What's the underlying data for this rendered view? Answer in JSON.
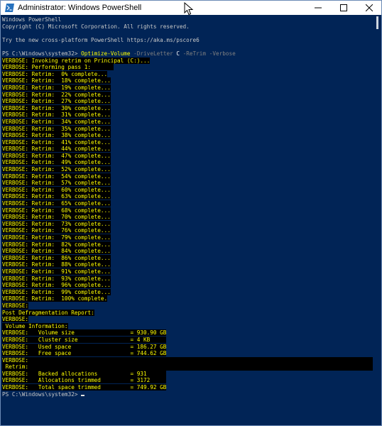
{
  "window": {
    "title": "Administrator: Windows PowerShell"
  },
  "console": {
    "header": [
      "Windows PowerShell",
      "Copyright (C) Microsoft Corporation. All rights reserved.",
      "",
      "Try the new cross-platform PowerShell https://aka.ms/pscore6",
      ""
    ],
    "command": {
      "prompt": "PS C:\\Windows\\system32> ",
      "cmdlet": "Optimize-Volume",
      "p1": "-DriveLetter",
      "a1": "C",
      "p2": "-ReTrim",
      "p3": "-Verbose"
    },
    "verbose_intro": [
      "VERBOSE: Invoking retrim on Principal (C:)...",
      "VERBOSE: Performing pass 1:"
    ],
    "progress": [
      "VERBOSE: Retrim:  0% complete...",
      "VERBOSE: Retrim:  18% complete...",
      "VERBOSE: Retrim:  19% complete...",
      "VERBOSE: Retrim:  22% complete...",
      "VERBOSE: Retrim:  27% complete...",
      "VERBOSE: Retrim:  30% complete...",
      "VERBOSE: Retrim:  31% complete...",
      "VERBOSE: Retrim:  34% complete...",
      "VERBOSE: Retrim:  35% complete...",
      "VERBOSE: Retrim:  38% complete...",
      "VERBOSE: Retrim:  41% complete...",
      "VERBOSE: Retrim:  44% complete...",
      "VERBOSE: Retrim:  47% complete...",
      "VERBOSE: Retrim:  49% complete...",
      "VERBOSE: Retrim:  52% complete...",
      "VERBOSE: Retrim:  54% complete...",
      "VERBOSE: Retrim:  57% complete...",
      "VERBOSE: Retrim:  60% complete...",
      "VERBOSE: Retrim:  63% complete...",
      "VERBOSE: Retrim:  65% complete...",
      "VERBOSE: Retrim:  68% complete...",
      "VERBOSE: Retrim:  70% complete...",
      "VERBOSE: Retrim:  73% complete...",
      "VERBOSE: Retrim:  76% complete...",
      "VERBOSE: Retrim:  79% complete...",
      "VERBOSE: Retrim:  82% complete...",
      "VERBOSE: Retrim:  84% complete...",
      "VERBOSE: Retrim:  86% complete...",
      "VERBOSE: Retrim:  88% complete...",
      "VERBOSE: Retrim:  91% complete...",
      "VERBOSE: Retrim:  93% complete...",
      "VERBOSE: Retrim:  96% complete...",
      "VERBOSE: Retrim:  99% complete...",
      "VERBOSE: Retrim:  100% complete."
    ],
    "report_lines": [
      "VERBOSE:",
      "Post Defragmentation Report:",
      "VERBOSE:",
      " Volume Information:",
      "VERBOSE:   Volume size                 = 930.90 GB",
      "VERBOSE:   Cluster size                = 4 KB",
      "VERBOSE:   Used space                  = 186.27 GB",
      "VERBOSE:   Free space                  = 744.62 GB",
      "VERBOSE:",
      " Retrim:",
      "VERBOSE:   Backed allocations          = 931",
      "VERBOSE:   Allocations trimmed         = 3172",
      "VERBOSE:   Total space trimmed         = 749.92 GB"
    ],
    "final_prompt": "PS C:\\Windows\\system32> "
  },
  "colors": {
    "background": "#012456",
    "verbose_text": "#ffff00",
    "verbose_bg": "#000000",
    "normal_text": "#c8c8c8"
  }
}
